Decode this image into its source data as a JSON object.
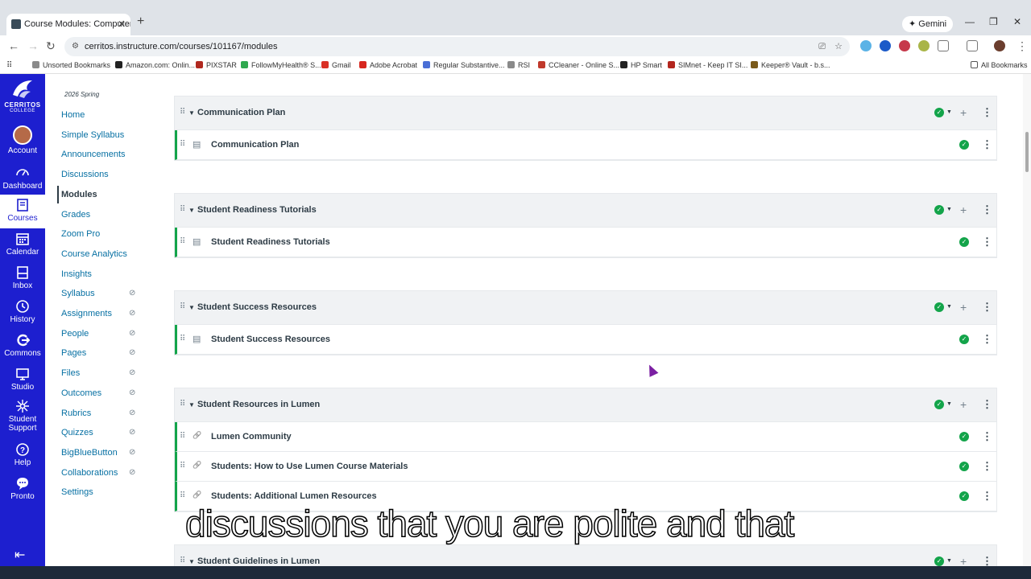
{
  "browser": {
    "tab_title": "Course Modules: Computer Ap",
    "url": "cerritos.instructure.com/courses/101167/modules",
    "gemini_label": "Gemini",
    "bookmarks": [
      {
        "label": "Unsorted Bookmarks",
        "color": "#8a8a8a"
      },
      {
        "label": "Amazon.com: Onlin...",
        "color": "#222222"
      },
      {
        "label": "PIXSTAR",
        "color": "#b0281f"
      },
      {
        "label": "FollowMyHealth® S...",
        "color": "#2fa84f"
      },
      {
        "label": "Gmail",
        "color": "#d93025"
      },
      {
        "label": "Adobe Acrobat",
        "color": "#d7261e"
      },
      {
        "label": "Regular Substantive...",
        "color": "#4a6fd6"
      },
      {
        "label": "RSI",
        "color": "#8a8a8a"
      },
      {
        "label": "CCleaner - Online S...",
        "color": "#c0392b"
      },
      {
        "label": "HP Smart",
        "color": "#222222"
      },
      {
        "label": "SIMnet - Keep IT SI...",
        "color": "#b3261e"
      },
      {
        "label": "Keeper® Vault - b.s...",
        "color": "#7a5a1a"
      }
    ],
    "all_bookmarks": "All Bookmarks"
  },
  "global_nav": {
    "logo_line1": "CERRITOS",
    "logo_line2": "COLLEGE",
    "items": [
      {
        "label": "Account",
        "icon": "avatar"
      },
      {
        "label": "Dashboard",
        "icon": "dashboard-icon"
      },
      {
        "label": "Courses",
        "icon": "courses-icon"
      },
      {
        "label": "Calendar",
        "icon": "calendar-icon"
      },
      {
        "label": "Inbox",
        "icon": "inbox-icon"
      },
      {
        "label": "History",
        "icon": "history-icon"
      },
      {
        "label": "Commons",
        "icon": "commons-icon"
      },
      {
        "label": "Studio",
        "icon": "studio-icon"
      },
      {
        "label": "Student",
        "label2": "Support",
        "icon": "support-icon"
      },
      {
        "label": "Help",
        "icon": "help-icon"
      },
      {
        "label": "Pronto",
        "icon": "pronto-icon"
      }
    ],
    "active": "Courses",
    "collapse_icon": "collapse-icon"
  },
  "course_nav": {
    "term": "2026 Spring",
    "items": [
      {
        "label": "Home",
        "hidden": false
      },
      {
        "label": "Simple Syllabus",
        "hidden": false
      },
      {
        "label": "Announcements",
        "hidden": false
      },
      {
        "label": "Discussions",
        "hidden": false
      },
      {
        "label": "Modules",
        "hidden": false
      },
      {
        "label": "Grades",
        "hidden": false
      },
      {
        "label": "Zoom Pro",
        "hidden": false
      },
      {
        "label": "Course Analytics",
        "hidden": false
      },
      {
        "label": "Insights",
        "hidden": false
      },
      {
        "label": "Syllabus",
        "hidden": true
      },
      {
        "label": "Assignments",
        "hidden": true
      },
      {
        "label": "People",
        "hidden": true
      },
      {
        "label": "Pages",
        "hidden": true
      },
      {
        "label": "Files",
        "hidden": true
      },
      {
        "label": "Outcomes",
        "hidden": true
      },
      {
        "label": "Rubrics",
        "hidden": true
      },
      {
        "label": "Quizzes",
        "hidden": true
      },
      {
        "label": "BigBlueButton",
        "hidden": true
      },
      {
        "label": "Collaborations",
        "hidden": true
      },
      {
        "label": "Settings",
        "hidden": false
      }
    ],
    "active": "Modules"
  },
  "modules": [
    {
      "title": "Communication Plan",
      "items": [
        {
          "title": "Communication Plan",
          "type": "page"
        }
      ]
    },
    {
      "title": "Student Readiness Tutorials",
      "items": [
        {
          "title": "Student Readiness Tutorials",
          "type": "page"
        }
      ]
    },
    {
      "title": "Student Success Resources",
      "items": [
        {
          "title": "Student Success Resources",
          "type": "page"
        }
      ]
    },
    {
      "title": "Student Resources in Lumen",
      "items": [
        {
          "title": "Lumen Community",
          "type": "link"
        },
        {
          "title": "Students: How to Use Lumen Course Materials",
          "type": "link"
        },
        {
          "title": "Students: Additional Lumen Resources",
          "type": "link"
        }
      ]
    },
    {
      "title": "Student Guidelines in Lumen",
      "items": []
    }
  ],
  "caption": "discussions  that you are polite and that",
  "colors": {
    "nav_bg": "#1d1fcf",
    "link": "#0770a3",
    "published": "#13a44a",
    "header_bg": "#f0f2f4"
  }
}
